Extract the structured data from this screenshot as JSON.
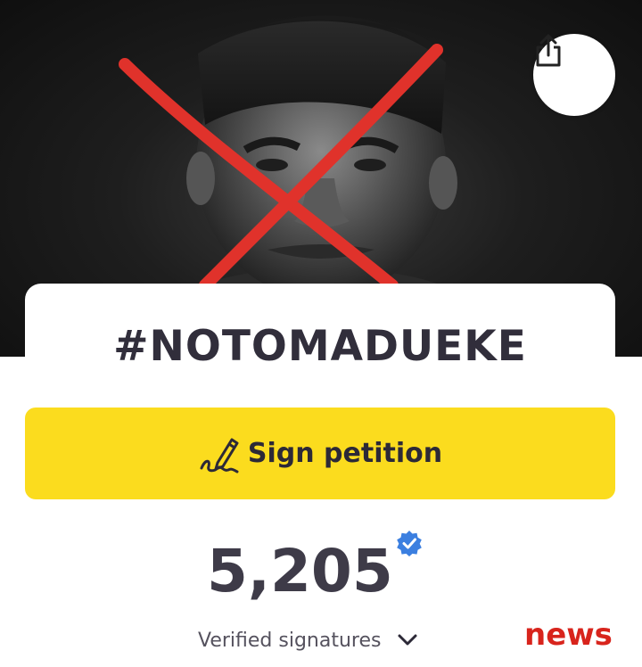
{
  "petition": {
    "title": "#NOTOMADUEKE",
    "sign_label": "Sign petition",
    "signature_count": "5,205",
    "verified_label": "Verified signatures",
    "verified_badge_icon": "verified-check-icon"
  },
  "share": {
    "icon": "share-icon"
  },
  "hero": {
    "description_icon": "crossed-out-photo",
    "cross_color": "#e0322b"
  },
  "watermark": {
    "text": "news"
  },
  "colors": {
    "button_yellow": "#fbdc1e",
    "text_dark": "#312e3b",
    "badge_blue": "#3b7fe0",
    "watermark_red": "#d8241c"
  }
}
